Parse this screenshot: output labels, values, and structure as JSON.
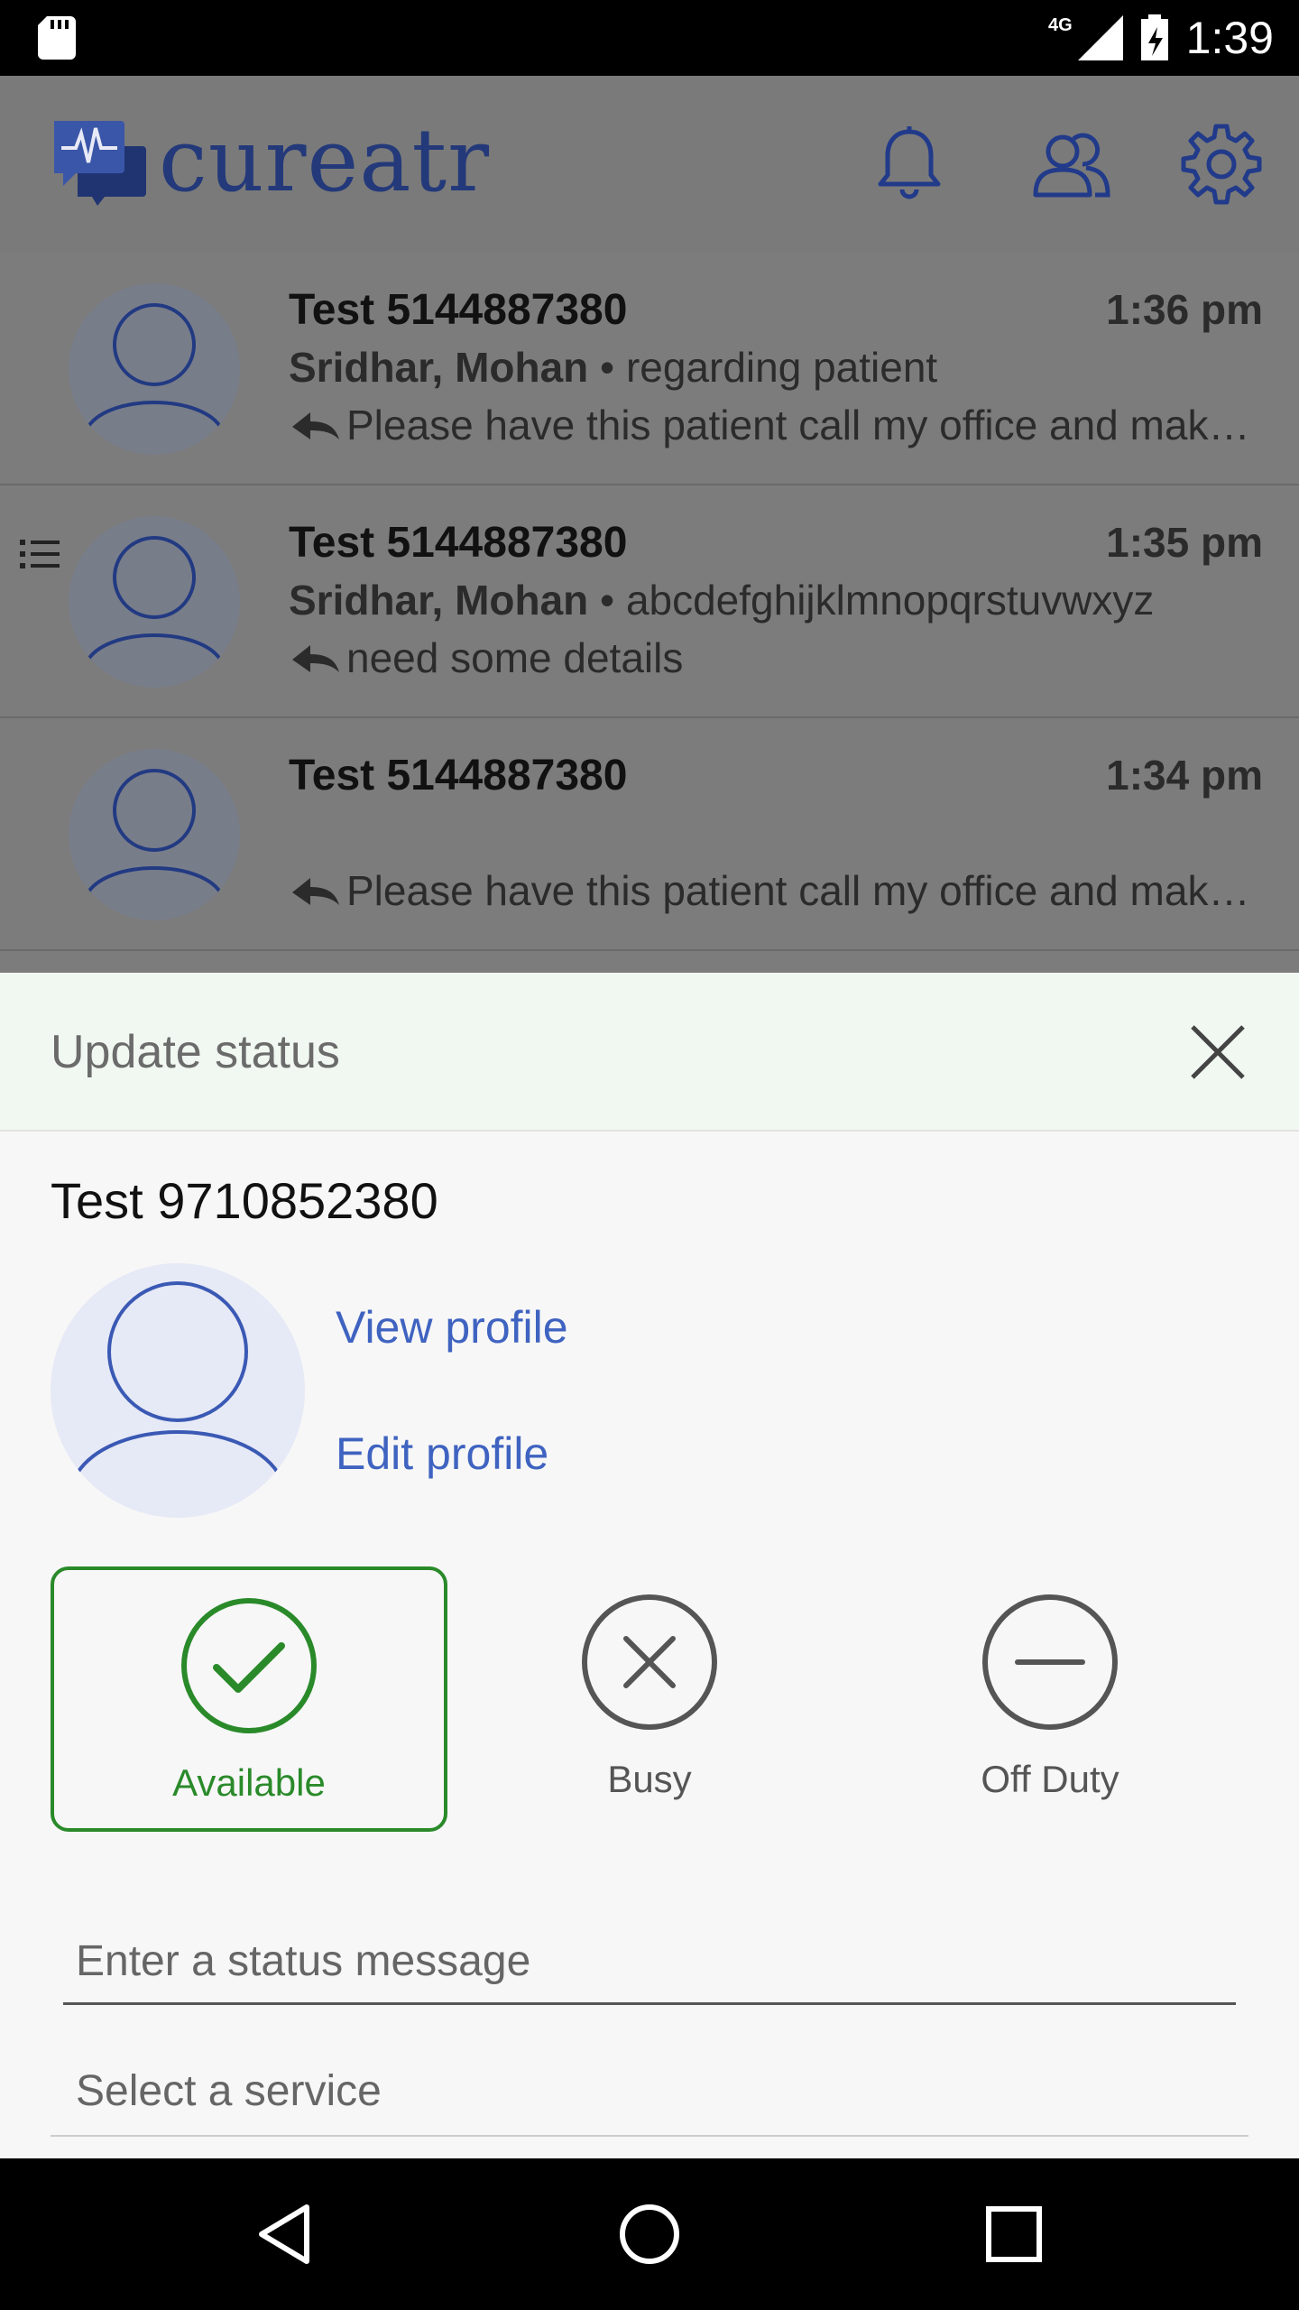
{
  "status_bar": {
    "network": "4G",
    "time": "1:39"
  },
  "app": {
    "name": "cureatr"
  },
  "messages": [
    {
      "title": "Test 5144887380",
      "time": "1:36 pm",
      "sender": "Sridhar, Mohan",
      "separator": " • ",
      "subject": "regarding patient",
      "preview": "Please have this patient call my office and make an appointment"
    },
    {
      "title": "Test 5144887380",
      "time": "1:35 pm",
      "sender": "Sridhar, Mohan",
      "separator": " • ",
      "subject": "abcdefghijklmnopqrstuvwxyz",
      "preview": "need some details"
    },
    {
      "title": "Test 5144887380",
      "time": "1:34 pm",
      "sender": "",
      "separator": "",
      "subject": "",
      "preview": "Please have this patient call my office and make an appointment"
    }
  ],
  "sheet": {
    "title": "Update status",
    "user_name": "Test 9710852380",
    "view_profile": "View profile",
    "edit_profile": "Edit profile",
    "statuses": [
      {
        "label": "Available",
        "selected": true,
        "color": "#2a8a2a"
      },
      {
        "label": "Busy",
        "selected": false,
        "color": "#555555"
      },
      {
        "label": "Off Duty",
        "selected": false,
        "color": "#555555"
      }
    ],
    "status_message_placeholder": "Enter a status message",
    "service_placeholder": "Select a service"
  }
}
